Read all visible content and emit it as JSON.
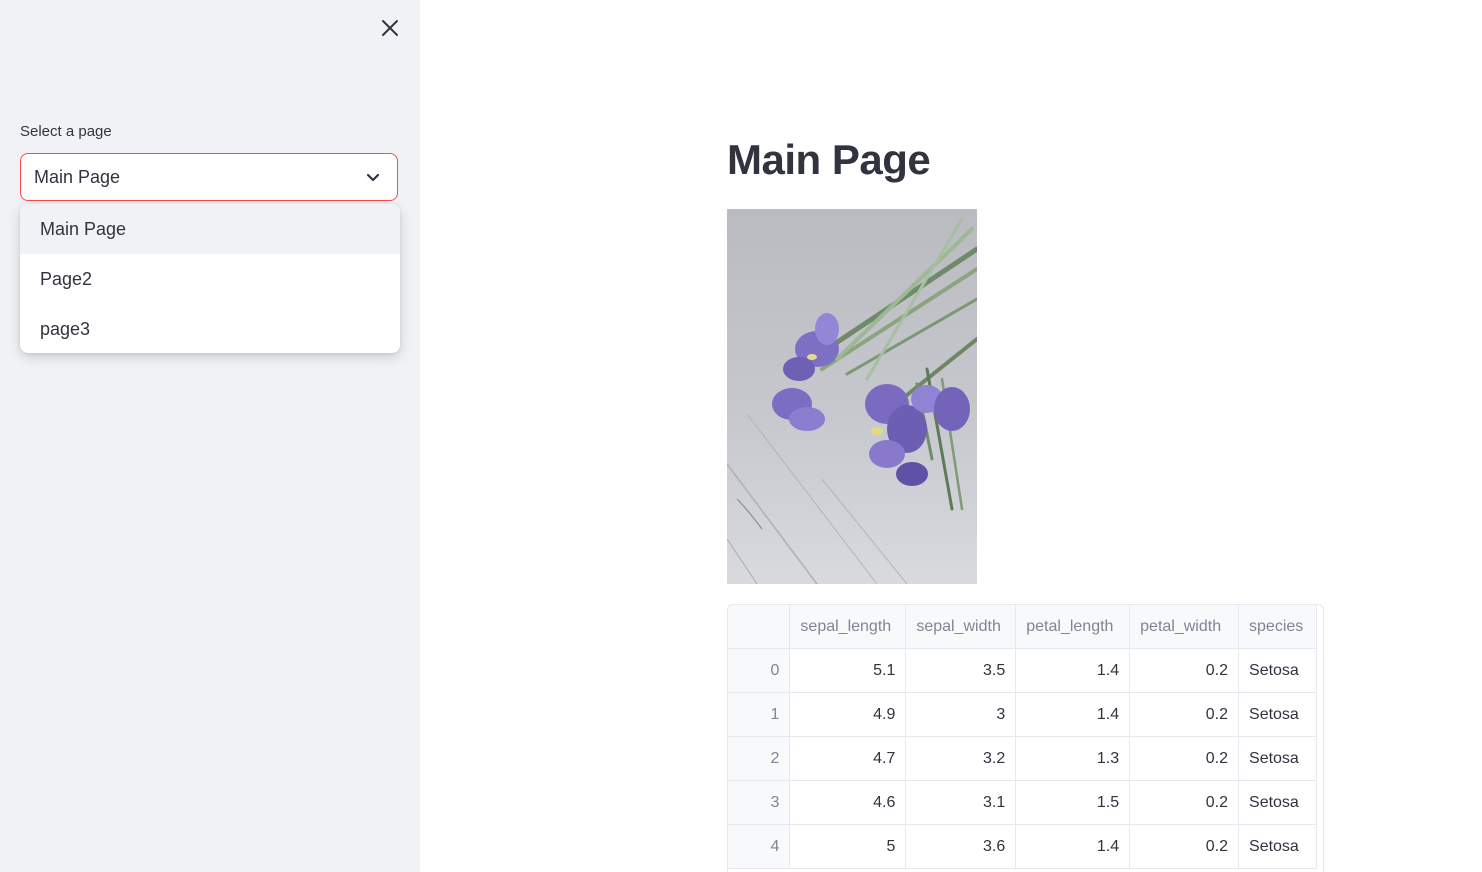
{
  "sidebar": {
    "close_icon": "close-icon",
    "select_label": "Select a page",
    "selected_value": "Main Page",
    "chevron_icon": "chevron-down-icon",
    "options": [
      "Main Page",
      "Page2",
      "page3"
    ]
  },
  "main": {
    "title": "Main Page",
    "image_subject": "purple iris flowers on grey wooden boards"
  },
  "table": {
    "columns": [
      "",
      "sepal_length",
      "sepal_width",
      "petal_length",
      "petal_width",
      "species"
    ],
    "rows": [
      {
        "index": "0",
        "sepal_length": "5.1",
        "sepal_width": "3.5",
        "petal_length": "1.4",
        "petal_width": "0.2",
        "species": "Setosa"
      },
      {
        "index": "1",
        "sepal_length": "4.9",
        "sepal_width": "3",
        "petal_length": "1.4",
        "petal_width": "0.2",
        "species": "Setosa"
      },
      {
        "index": "2",
        "sepal_length": "4.7",
        "sepal_width": "3.2",
        "petal_length": "1.3",
        "petal_width": "0.2",
        "species": "Setosa"
      },
      {
        "index": "3",
        "sepal_length": "4.6",
        "sepal_width": "3.1",
        "petal_length": "1.5",
        "petal_width": "0.2",
        "species": "Setosa"
      },
      {
        "index": "4",
        "sepal_length": "5",
        "sepal_width": "3.6",
        "petal_length": "1.4",
        "petal_width": "0.2",
        "species": "Setosa"
      }
    ]
  },
  "colors": {
    "accent": "#ff4b4b",
    "sidebar_bg": "#f0f2f6",
    "text": "#31333f",
    "muted_text": "#808495"
  }
}
